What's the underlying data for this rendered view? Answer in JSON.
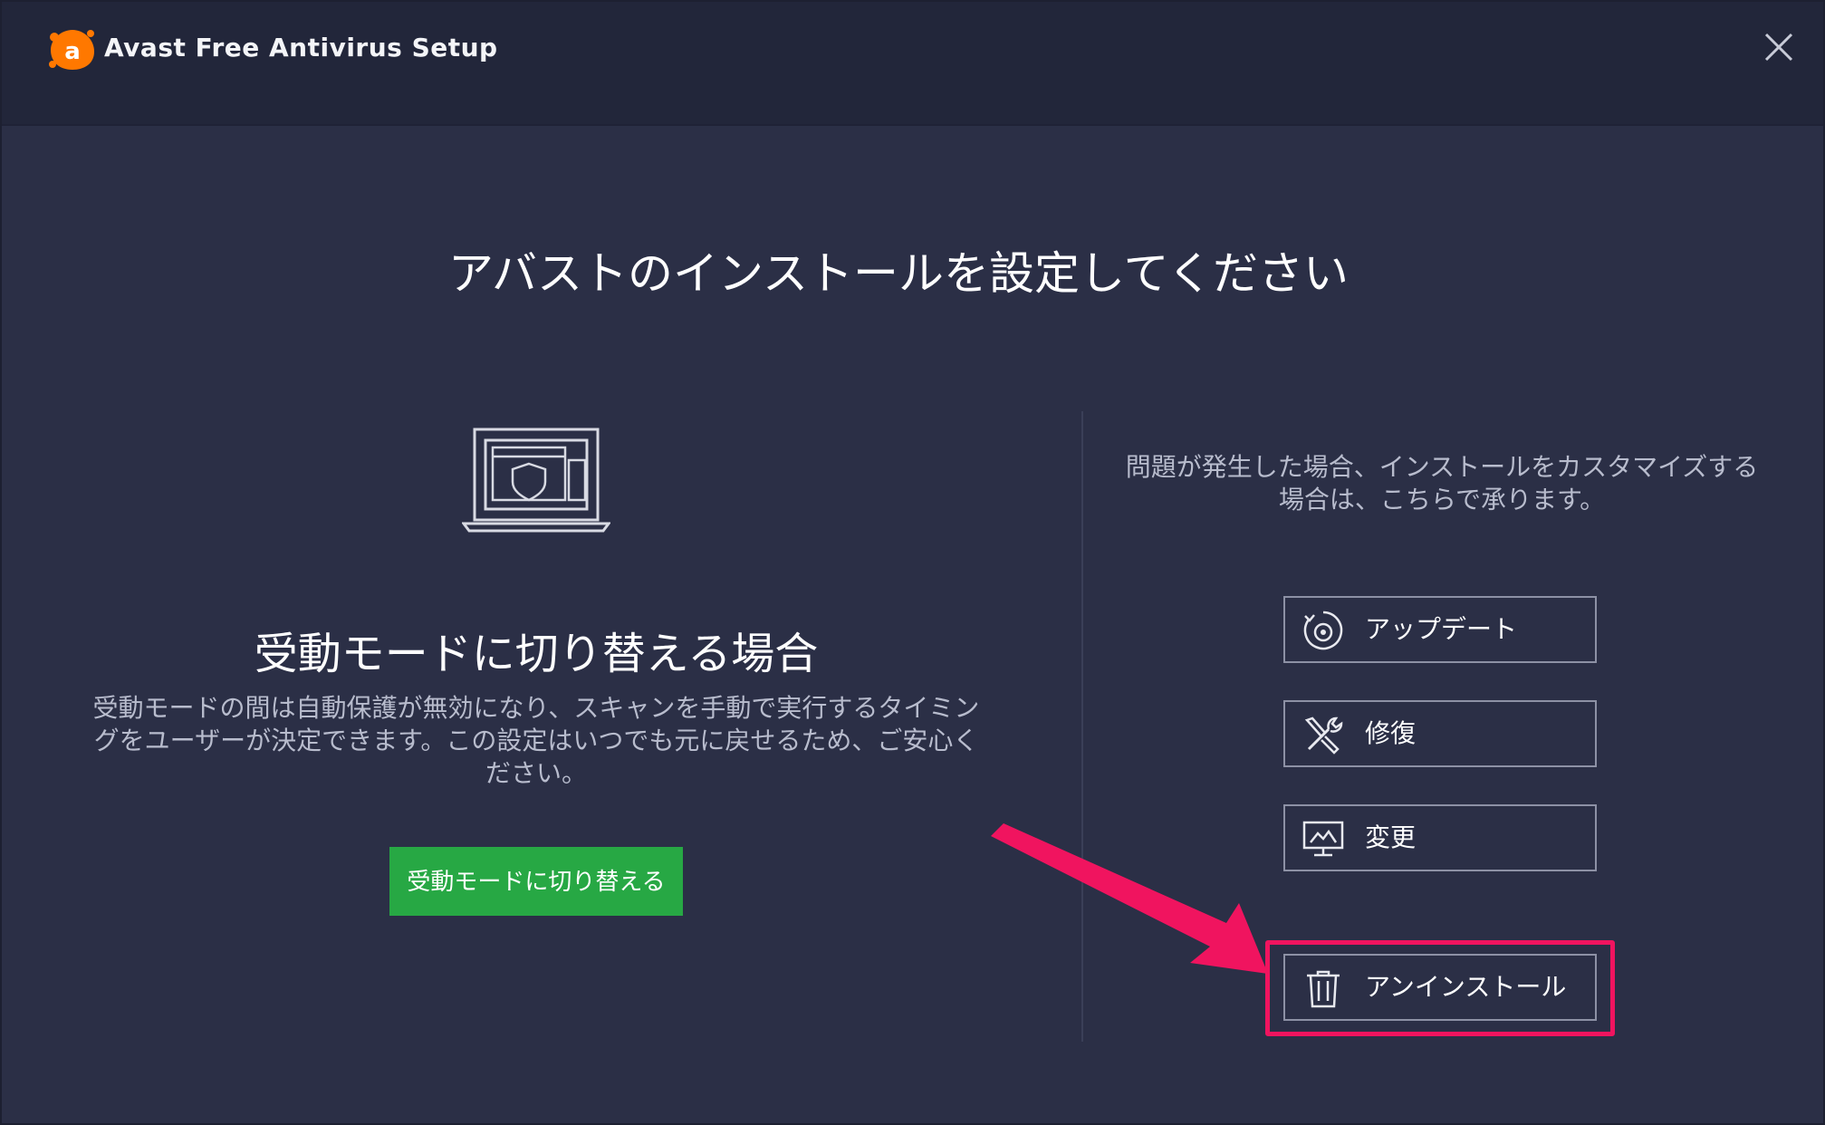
{
  "window": {
    "title": "Avast Free Antivirus Setup"
  },
  "main": {
    "title": "アバストのインストールを設定してください"
  },
  "passive_mode": {
    "heading": "受動モードに切り替える場合",
    "description_lines": [
      "受動モードの間は自動保護が無効になり、スキャンを手動で実行するタイミン",
      "グをユーザーが決定できます。この設定はいつでも元に戻せるため、ご安心く",
      "ださい。"
    ],
    "button_label": "受動モードに切り替える"
  },
  "customize": {
    "description_lines": [
      "問題が発生した場合、インストールをカスタマイズする",
      "場合は、こちらで承ります。"
    ],
    "actions": [
      {
        "id": "update",
        "label": "アップデート",
        "icon": "refresh-disc-icon"
      },
      {
        "id": "repair",
        "label": "修復",
        "icon": "wrench-screwdriver-icon"
      },
      {
        "id": "modify",
        "label": "変更",
        "icon": "monitor-settings-icon"
      },
      {
        "id": "uninstall",
        "label": "アンインストール",
        "icon": "trash-icon"
      }
    ]
  },
  "colors": {
    "background": "#2b2f46",
    "titlebar": "#22263a",
    "accent_green": "#27a844",
    "brand_orange": "#ff7800",
    "annotation_pink": "#f0145f"
  }
}
